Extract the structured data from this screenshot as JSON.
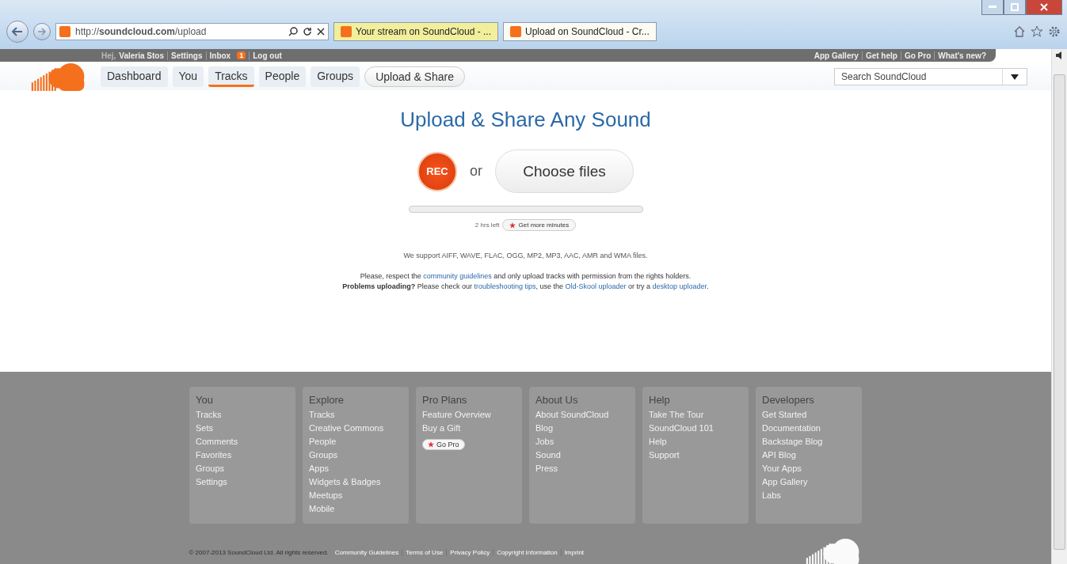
{
  "browser": {
    "address": "http://**soundcloud.com**/upload",
    "tabs": [
      {
        "title": "Your stream on SoundCloud - ...",
        "selected": false
      },
      {
        "title": "Upload on SoundCloud - Cr...",
        "selected": true
      }
    ]
  },
  "topbar": {
    "greeting": "Hej,",
    "user": "Valeria Stos",
    "links": [
      "Settings",
      "Inbox"
    ],
    "inbox_count": "1",
    "logout": "Log out",
    "right_links": [
      "App Gallery",
      "Get help",
      "Go Pro",
      "What's new?"
    ]
  },
  "nav": [
    {
      "label": "Dashboard",
      "kind": "tab",
      "selected": false
    },
    {
      "label": "You",
      "kind": "tab",
      "selected": false
    },
    {
      "label": "Tracks",
      "kind": "tab",
      "selected": true
    },
    {
      "label": "People",
      "kind": "tab",
      "selected": false
    },
    {
      "label": "Groups",
      "kind": "tab",
      "selected": false
    },
    {
      "label": "Upload & Share",
      "kind": "button",
      "selected": false
    }
  ],
  "search": {
    "placeholder": "Search SoundCloud"
  },
  "upload": {
    "title": "Upload & Share Any Sound",
    "rec": "REC",
    "or": "or",
    "choose": "Choose files",
    "time_left": "2 hrs left",
    "more_minutes": "Get more minutes",
    "formats": "We support AIFF, WAVE, FLAC, OGG, MP2, MP3, AAC, AMR and WMA files.",
    "paragraphs": [
      [
        {
          "text": "Please, respect the ",
          "link": false
        },
        {
          "text": "community guidelines",
          "link": true
        },
        {
          "text": " and only upload tracks with permission from the rights holders.",
          "link": false
        }
      ],
      [
        {
          "text": "**Problems uploading?** Please check our ",
          "link": false
        },
        {
          "text": "troubleshooting tips",
          "link": true
        },
        {
          "text": ", use the ",
          "link": false
        },
        {
          "text": "Old-Skool uploader",
          "link": true
        },
        {
          "text": " or try a ",
          "link": false
        },
        {
          "text": "desktop uploader",
          "link": true
        },
        {
          "text": ".",
          "link": false
        }
      ]
    ]
  },
  "footer": {
    "columns": [
      {
        "heading": "You",
        "links": [
          "Tracks",
          "Sets",
          "Comments",
          "Favorites",
          "Groups",
          "Settings"
        ]
      },
      {
        "heading": "Explore",
        "links": [
          "Tracks",
          "Creative Commons",
          "People",
          "Groups",
          "Apps",
          "Widgets & Badges",
          "Meetups",
          "Mobile"
        ]
      },
      {
        "heading": "Pro Plans",
        "links": [
          "Feature Overview",
          "Buy a Gift"
        ],
        "button": "Go Pro"
      },
      {
        "heading": "About Us",
        "links": [
          "About SoundCloud",
          "Blog",
          "Jobs",
          "Sound",
          "Press"
        ]
      },
      {
        "heading": "Help",
        "links": [
          "Take The Tour",
          "SoundCloud 101",
          "Help",
          "Support"
        ]
      },
      {
        "heading": "Developers",
        "links": [
          "Get Started",
          "Documentation",
          "Backstage Blog",
          "API Blog",
          "Your Apps",
          "App Gallery",
          "Labs"
        ]
      }
    ],
    "copyright": "© 2007-2013 SoundCloud Ltd. All rights reserved.",
    "links": [
      "Community Guidelines",
      "Terms of Use",
      "Privacy Policy",
      "Copyright Information",
      "Imprint"
    ]
  }
}
